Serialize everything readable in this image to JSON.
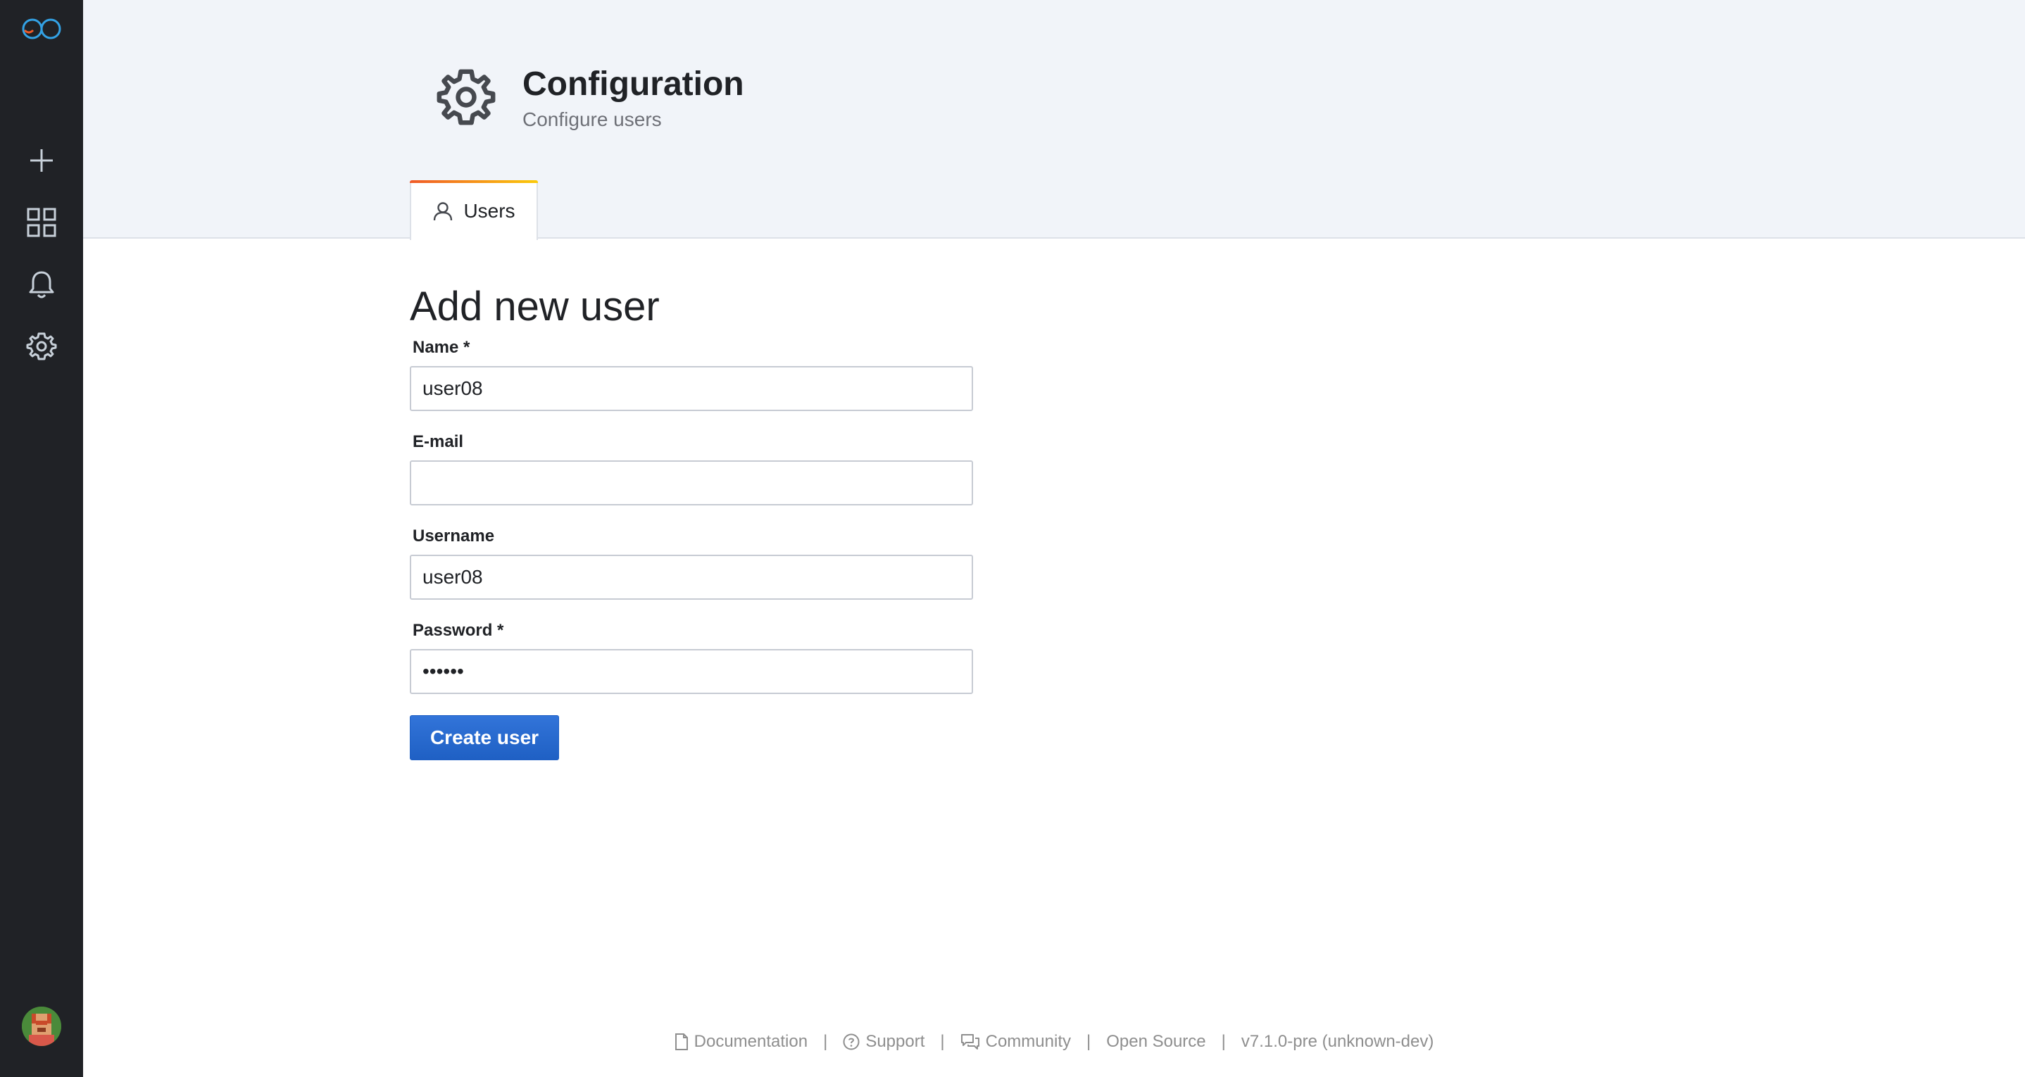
{
  "header": {
    "title": "Configuration",
    "subtitle": "Configure users",
    "icon": "gear-icon"
  },
  "tabs": [
    {
      "label": "Users",
      "icon": "user-icon",
      "active": true
    }
  ],
  "sidebar": {
    "items": [
      {
        "name": "logo",
        "icon": "logo-icon"
      },
      {
        "name": "create",
        "icon": "plus-icon"
      },
      {
        "name": "dashboards",
        "icon": "grid-icon"
      },
      {
        "name": "alerting",
        "icon": "bell-icon"
      },
      {
        "name": "configuration",
        "icon": "gear-icon"
      },
      {
        "name": "profile",
        "icon": "avatar"
      }
    ]
  },
  "form": {
    "title": "Add new user",
    "fields": {
      "name": {
        "label": "Name *",
        "value": "user08"
      },
      "email": {
        "label": "E-mail",
        "value": ""
      },
      "username": {
        "label": "Username",
        "value": "user08"
      },
      "password": {
        "label": "Password *",
        "value": "******"
      }
    },
    "submit_label": "Create user"
  },
  "footer": {
    "links": [
      "Documentation",
      "Support",
      "Community",
      "Open Source"
    ],
    "version": "v7.1.0-pre (unknown-dev)"
  },
  "colors": {
    "sidebar_bg": "#202226",
    "header_bg": "#f1f4f9",
    "primary_button": "#3274d9",
    "tab_accent_start": "#f05a28",
    "tab_accent_end": "#fbca0a"
  }
}
